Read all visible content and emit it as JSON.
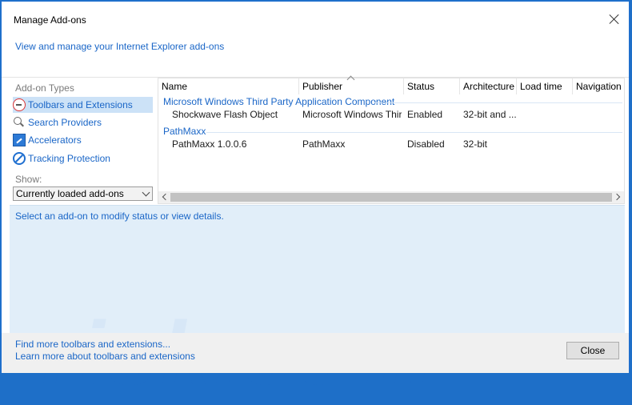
{
  "window": {
    "title": "Manage Add-ons"
  },
  "header": {
    "link_text": "View and manage your Internet Explorer add-ons"
  },
  "sidebar": {
    "types_label": "Add-on Types",
    "items": [
      {
        "label": "Toolbars and Extensions",
        "icon": "toolbar-extension-icon",
        "selected": true
      },
      {
        "label": "Search Providers",
        "icon": "search-icon",
        "selected": false
      },
      {
        "label": "Accelerators",
        "icon": "accelerator-icon",
        "selected": false
      },
      {
        "label": "Tracking Protection",
        "icon": "tracking-protection-icon",
        "selected": false
      }
    ],
    "show_label": "Show:",
    "show_value": "Currently loaded add-ons"
  },
  "list": {
    "columns": [
      "Name",
      "Publisher",
      "Status",
      "Architecture",
      "Load time",
      "Navigation ..."
    ],
    "groups": [
      {
        "name": "Microsoft Windows Third Party Application Component",
        "rows": [
          {
            "name": "Shockwave Flash Object",
            "publisher": "Microsoft Windows Third...",
            "status": "Enabled",
            "architecture": "32-bit and ..."
          }
        ]
      },
      {
        "name": "PathMaxx",
        "rows": [
          {
            "name": "PathMaxx 1.0.0.6",
            "publisher": "PathMaxx",
            "status": "Disabled",
            "architecture": "32-bit"
          }
        ]
      }
    ]
  },
  "details": {
    "text": "Select an add-on to modify status or view details."
  },
  "footer": {
    "link1": "Find more toolbars and extensions...",
    "link2": "Learn more about toolbars and extensions",
    "close_label": "Close"
  },
  "watermark": "risk.com",
  "colors": {
    "accent": "#1a66c7",
    "selection": "#cce2f7",
    "details_bg": "#e1eef9",
    "frame": "#1e6fc8"
  }
}
